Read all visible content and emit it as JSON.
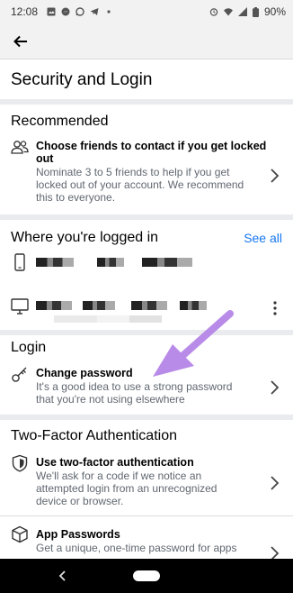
{
  "status_bar": {
    "time": "12:08",
    "battery": "90%"
  },
  "header": {
    "back_icon": "back-arrow-icon"
  },
  "page": {
    "title": "Security and Login"
  },
  "recommended": {
    "heading": "Recommended",
    "item": {
      "icon": "friends-icon",
      "title_line1": "Choose friends to contact if you get locked",
      "title_line2": "out",
      "desc_line1": "Nominate 3 to 5 friends to help if you get",
      "desc_line2": "locked out of your account. We recommend",
      "desc_line3": "this to everyone."
    }
  },
  "logged_in": {
    "heading": "Where you're logged in",
    "see_all": "See all",
    "devices": [
      {
        "icon": "phone-icon"
      },
      {
        "icon": "desktop-icon"
      }
    ]
  },
  "login": {
    "heading": "Login",
    "item": {
      "icon": "key-icon",
      "title": "Change password",
      "desc_line1": "It's a good idea to use a strong password",
      "desc_line2": "that you're not using elsewhere"
    }
  },
  "two_factor": {
    "heading": "Two-Factor Authentication",
    "items": [
      {
        "icon": "shield-icon",
        "title": "Use two-factor authentication",
        "desc_line1": "We'll ask for a code if we notice an",
        "desc_line2": "attempted login from an unrecognized",
        "desc_line3": "device or browser."
      },
      {
        "icon": "cube-icon",
        "title": "App Passwords",
        "desc_line1": "Get a unique, one-time password for apps"
      }
    ]
  },
  "annotation": {
    "color": "#b98be8"
  }
}
